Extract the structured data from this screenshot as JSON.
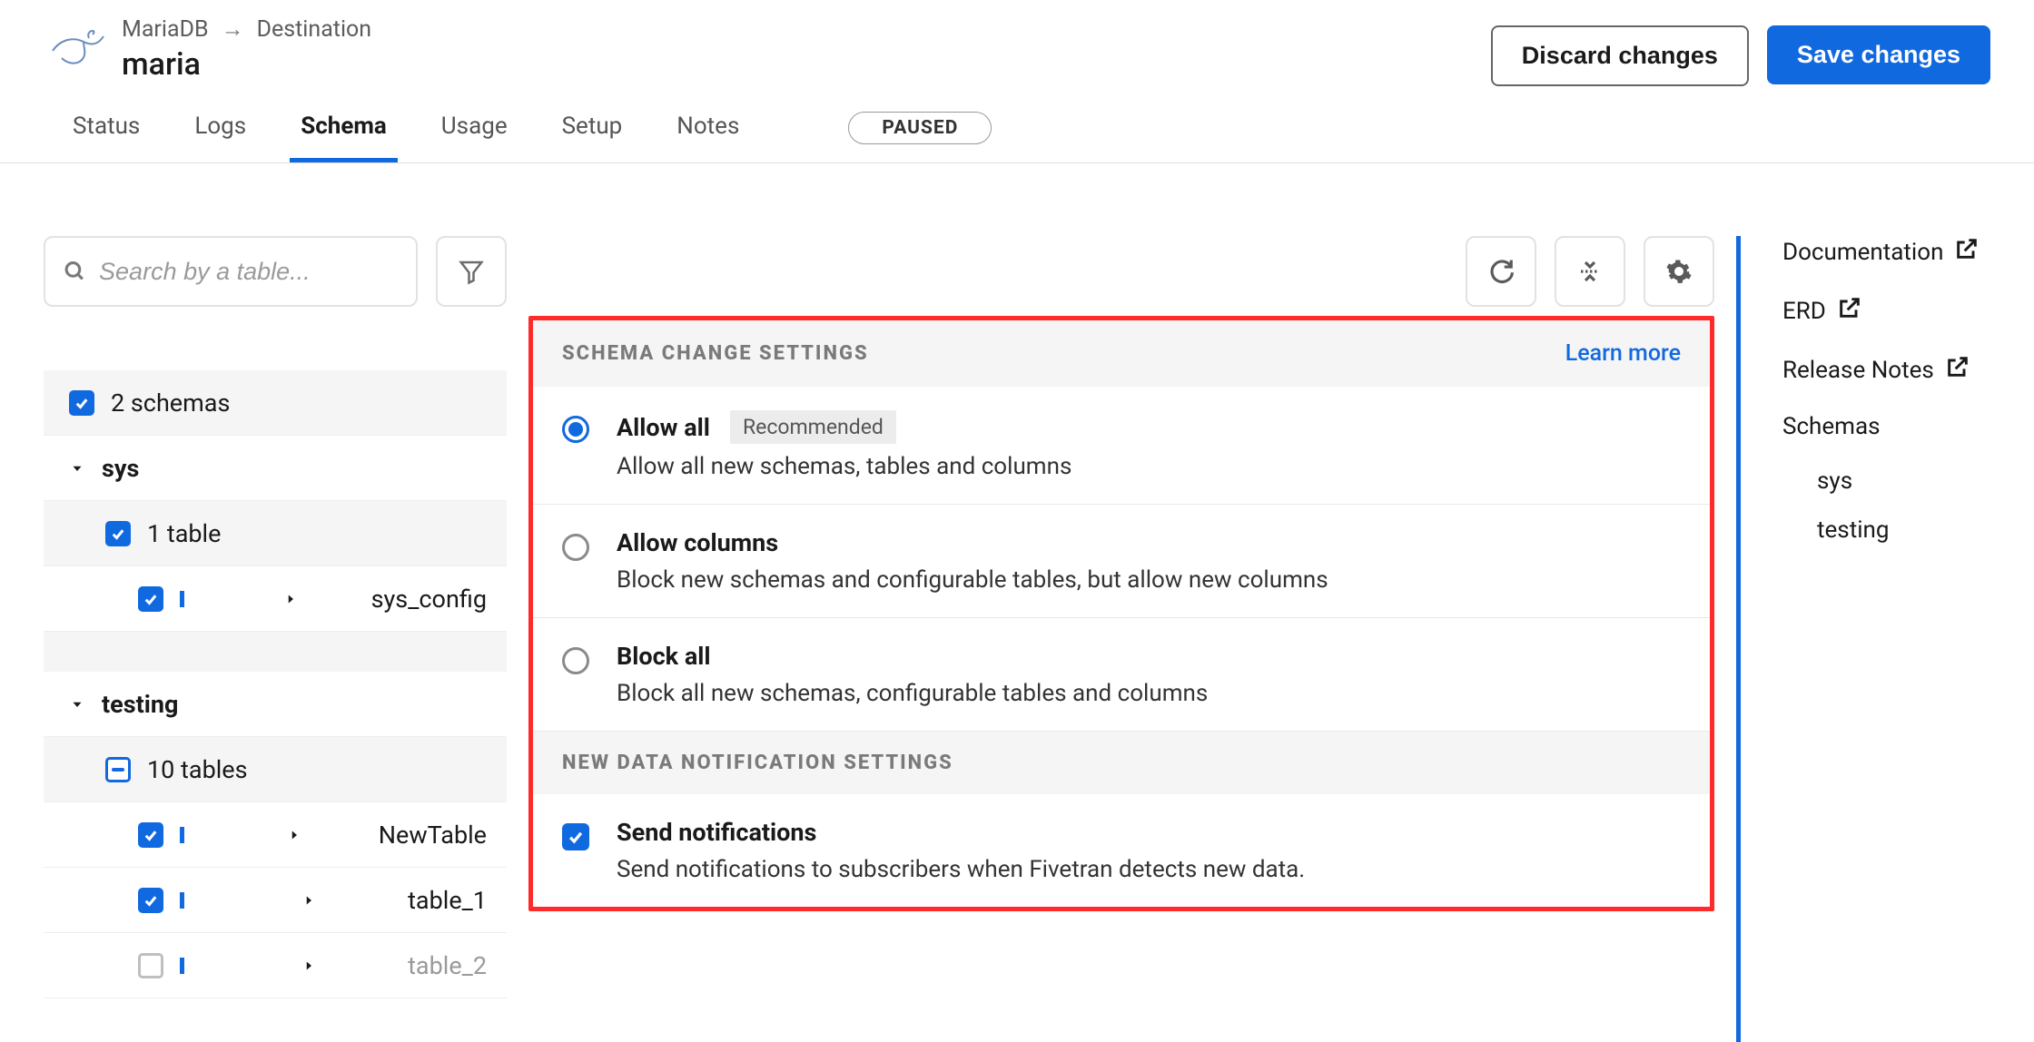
{
  "breadcrumb": {
    "connector": "MariaDB",
    "destination": "Destination"
  },
  "page_title": "maria",
  "header_actions": {
    "discard": "Discard changes",
    "save": "Save changes"
  },
  "tabs": {
    "items": [
      "Status",
      "Logs",
      "Schema",
      "Usage",
      "Setup",
      "Notes"
    ],
    "active_index": 2
  },
  "status_pill": "PAUSED",
  "search": {
    "placeholder": "Search by a table..."
  },
  "tree": {
    "summary": "2 schemas",
    "schemas": [
      {
        "name": "sys",
        "table_summary": "1 table",
        "tables": [
          "sys_config"
        ]
      },
      {
        "name": "testing",
        "table_summary": "10 tables",
        "tables": [
          "NewTable",
          "table_1",
          "table_2"
        ]
      }
    ]
  },
  "settings": {
    "schema_change_header": "SCHEMA CHANGE SETTINGS",
    "learn_more": "Learn more",
    "options": [
      {
        "title": "Allow all",
        "badge": "Recommended",
        "desc": "Allow all new schemas, tables and columns",
        "selected": true
      },
      {
        "title": "Allow columns",
        "badge": null,
        "desc": "Block new schemas and configurable tables, but allow new columns",
        "selected": false
      },
      {
        "title": "Block all",
        "badge": null,
        "desc": "Block all new schemas, configurable tables and columns",
        "selected": false
      }
    ],
    "notification_header": "NEW DATA NOTIFICATION SETTINGS",
    "notification": {
      "title": "Send notifications",
      "desc": "Send notifications to subscribers when Fivetran detects new data."
    }
  },
  "right_links": {
    "documentation": "Documentation",
    "erd": "ERD",
    "release_notes": "Release Notes",
    "schemas_label": "Schemas",
    "schema_items": [
      "sys",
      "testing"
    ]
  }
}
